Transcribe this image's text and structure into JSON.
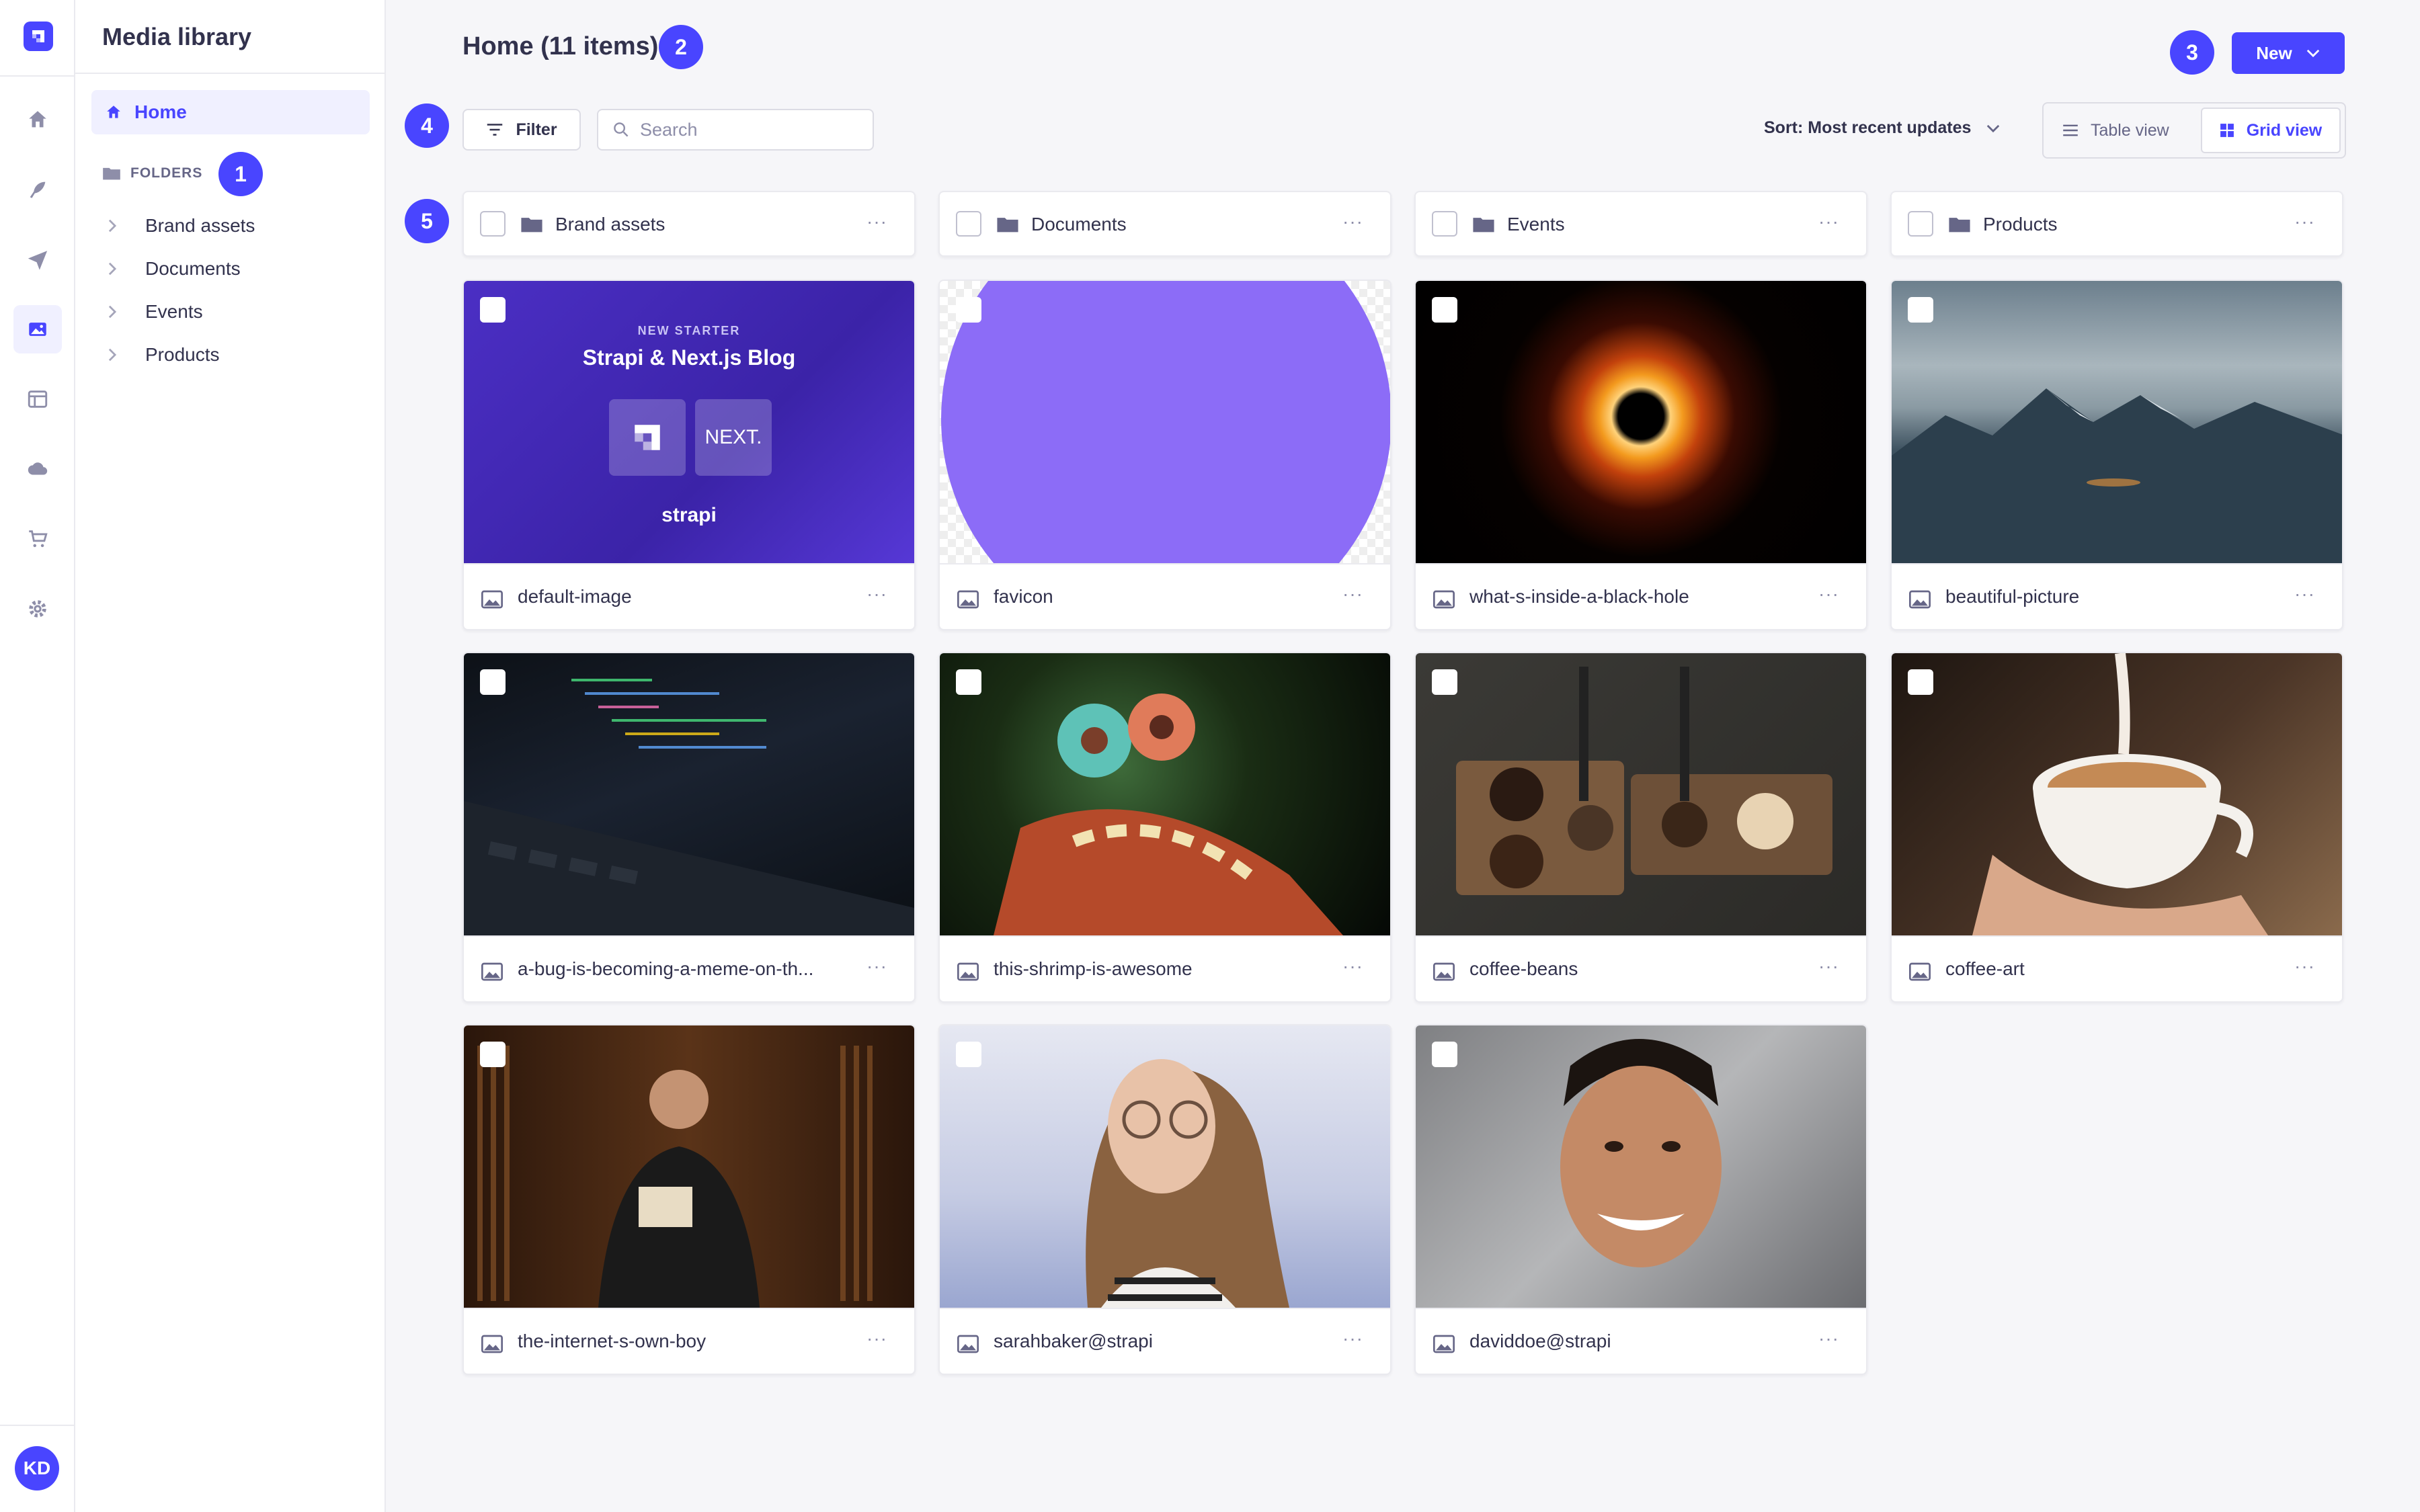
{
  "nav": {
    "avatar_initials": "KD",
    "items": [
      "home-icon",
      "feather-icon",
      "paper-plane-icon",
      "media-icon",
      "layout-icon",
      "cloud-icon",
      "cart-icon",
      "gear-icon"
    ],
    "active_index": 3
  },
  "subnav": {
    "title": "Media library",
    "home_label": "Home",
    "folders_label": "FOLDERS",
    "folders": [
      "Brand assets",
      "Documents",
      "Events",
      "Products"
    ]
  },
  "header": {
    "title": "Home (11 items)",
    "new_label": "New"
  },
  "toolbar": {
    "filter_label": "Filter",
    "search_placeholder": "Search",
    "sort_label": "Sort: Most recent updates",
    "table_view_label": "Table view",
    "grid_view_label": "Grid view"
  },
  "badges": [
    "1",
    "2",
    "3",
    "4",
    "5"
  ],
  "folders": [
    {
      "name": "Brand assets"
    },
    {
      "name": "Documents"
    },
    {
      "name": "Events"
    },
    {
      "name": "Products"
    }
  ],
  "assets": [
    {
      "name": "default-image",
      "thumb_text": {
        "kicker": "NEW STARTER",
        "headline": "Strapi & Next.js Blog",
        "brand": "strapi",
        "next": "NEXT."
      }
    },
    {
      "name": "favicon"
    },
    {
      "name": "what-s-inside-a-black-hole"
    },
    {
      "name": "beautiful-picture"
    },
    {
      "name": "a-bug-is-becoming-a-meme-on-th..."
    },
    {
      "name": "this-shrimp-is-awesome"
    },
    {
      "name": "coffee-beans"
    },
    {
      "name": "coffee-art"
    },
    {
      "name": "the-internet-s-own-boy"
    },
    {
      "name": "sarahbaker@strapi"
    },
    {
      "name": "daviddoe@strapi"
    }
  ],
  "colors": {
    "primary": "#4945ff",
    "bg": "#f6f6f9",
    "text": "#32324d"
  }
}
